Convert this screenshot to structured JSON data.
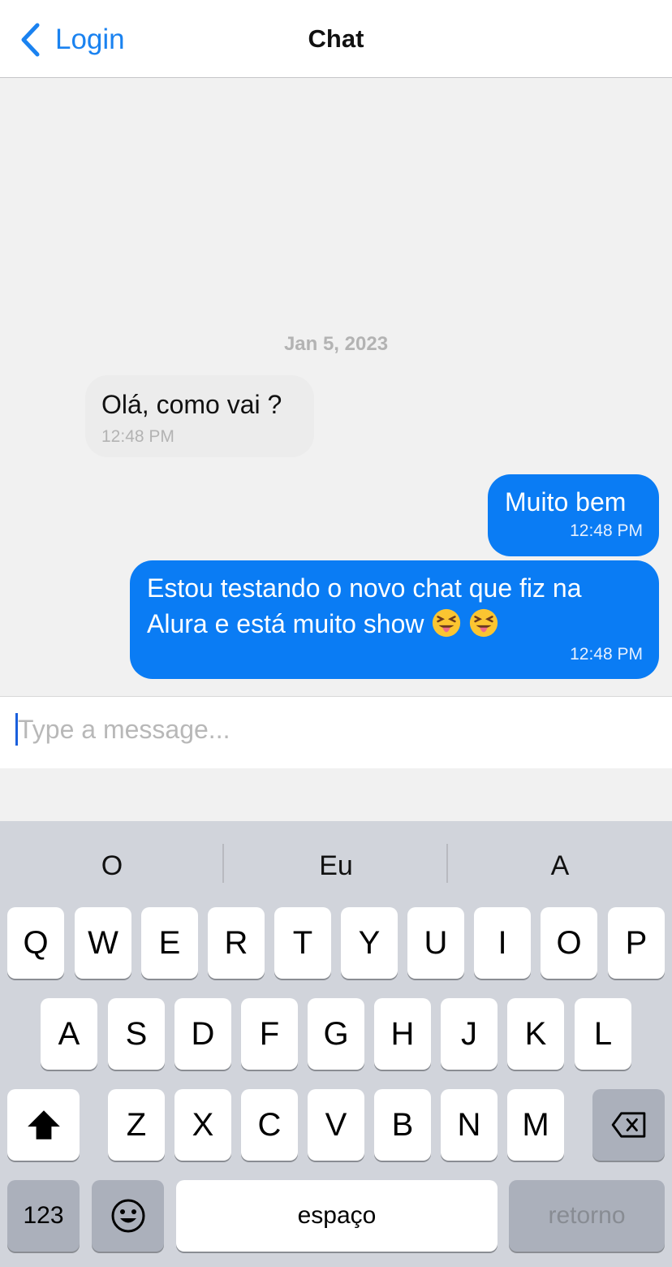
{
  "header": {
    "back_label": "Login",
    "title": "Chat"
  },
  "conversation": {
    "date": "Jan 5, 2023",
    "messages": [
      {
        "direction": "incoming",
        "text": "Olá, como vai ?",
        "time": "12:48 PM"
      },
      {
        "direction": "outgoing",
        "text": "Muito bem",
        "time": "12:48 PM"
      },
      {
        "direction": "outgoing",
        "text_line1": "Estou testando o novo chat que fiz na",
        "text_line2": "Alura e está muito show",
        "emoji": [
          "😝",
          "😝"
        ],
        "time": "12:48 PM"
      }
    ]
  },
  "composer": {
    "placeholder": "Type a message..."
  },
  "keyboard": {
    "suggestions": [
      "O",
      "Eu",
      "A"
    ],
    "row1": [
      "Q",
      "W",
      "E",
      "R",
      "T",
      "Y",
      "U",
      "I",
      "O",
      "P"
    ],
    "row2": [
      "A",
      "S",
      "D",
      "F",
      "G",
      "H",
      "J",
      "K",
      "L"
    ],
    "row3": [
      "Z",
      "X",
      "C",
      "V",
      "B",
      "N",
      "M"
    ],
    "numbers_label": "123",
    "space_label": "espaço",
    "return_label": "retorno",
    "icons": {
      "shift": "shift-arrow-icon",
      "delete": "backspace-icon",
      "emoji": "smiley-icon",
      "back": "chevron-left-icon"
    }
  },
  "colors": {
    "accent": "#1a82f0",
    "outgoing_bubble": "#0a7cf4",
    "incoming_bubble": "#ececec",
    "keyboard_bg": "#d1d4db"
  }
}
